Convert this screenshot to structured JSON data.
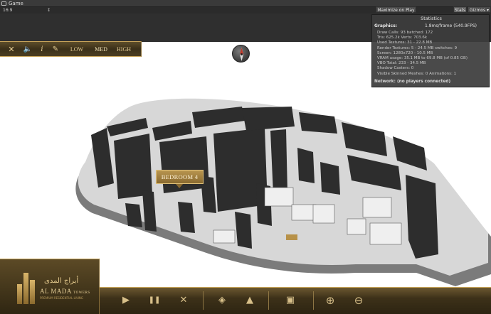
{
  "editor": {
    "tab_title": "Game",
    "aspect": "16:9",
    "aspect_caret": "↕",
    "maximize_label": "Maximize on Play",
    "stats_label": "Stats",
    "gizmos_label": "Gizmos ▾"
  },
  "statistics": {
    "title": "Statistics",
    "graphics_label": "Graphics:",
    "fps": "1.8ms/frame (540.9FPS)",
    "lines": [
      "Draw Calls: 93     batched: 172",
      "Tris: 625.2k     Verts: 703.6k",
      "Used Textures: 31 - 22.8 MB",
      "Render Textures: 5 - 24.5 MB     switches: 9",
      "Screen: 1280x720 - 10.5 MB",
      "VRAM usage: 35.1 MB to 69.8 MB (of 0.85 GB)",
      "VBO Total: 233 - 34.5 MB",
      "Shadow Casters: 0",
      "Visible Skinned Meshes: 0     Animations: 1"
    ],
    "network": "Network: (no players connected)"
  },
  "menu": {
    "close": "✕",
    "sound": "🔈",
    "info": "i",
    "settings": "✎",
    "low": "LOW",
    "med": "MED",
    "high": "HIGH"
  },
  "room_label": "BEDROOM 4",
  "bottom_bar": {
    "play": "▶",
    "pause": "❚❚",
    "mute": "✕",
    "view": "◈",
    "walk": "▲",
    "floor": "▣",
    "zoom_in": "⊕",
    "zoom_out": "⊖"
  },
  "logo": {
    "arabic": "أبراج المدى",
    "name": "AL MADA",
    "name_suffix": "TOWERS",
    "tagline": "PREMIUM RESIDENTIAL LIVING"
  },
  "colors": {
    "gold": "#c9a55a",
    "gold_text": "#e7cf95",
    "editor_dark": "#2b2b2b"
  }
}
